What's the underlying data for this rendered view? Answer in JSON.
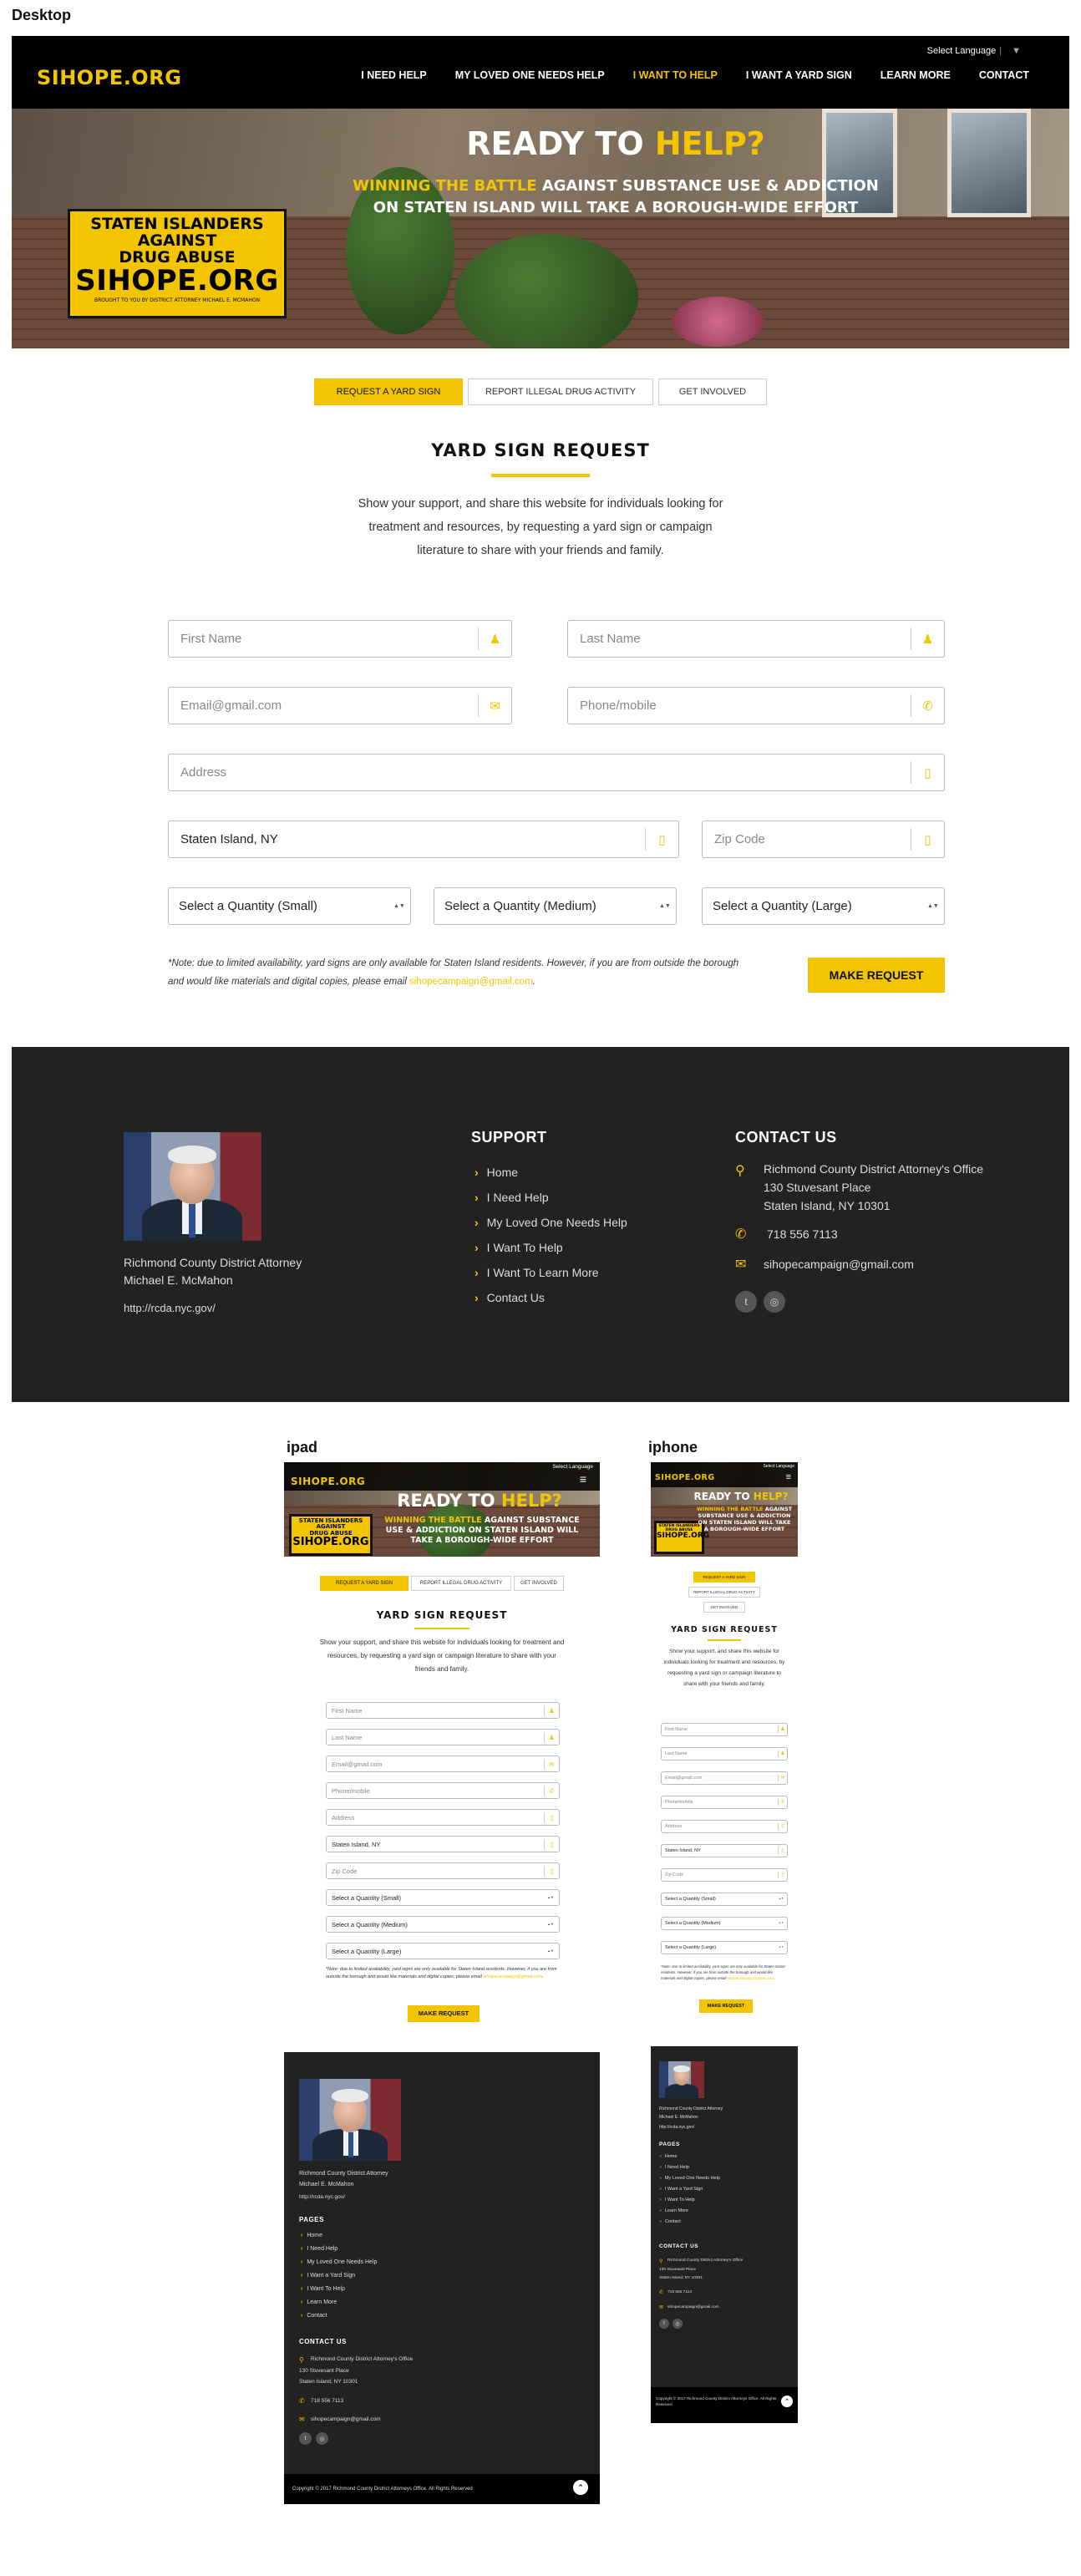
{
  "labels": {
    "desktop": "Desktop",
    "ipad": "ipad",
    "iphone": "iphone"
  },
  "site": {
    "logo": "SIHOPE.ORG",
    "language": "Select Language",
    "language_arrow": "▼",
    "menu_icon": "≡",
    "nav": [
      "I NEED HELP",
      "MY LOVED ONE NEEDS HELP",
      "I WANT TO HELP",
      "I WANT A YARD SIGN",
      "LEARN MORE",
      "CONTACT"
    ]
  },
  "hero": {
    "title_a": "READY TO ",
    "title_b": "HELP?",
    "line1_a": "WINNING THE BATTLE",
    "line1_b": " AGAINST SUBSTANCE USE & ADDICTION",
    "line2": "ON STATEN ISLAND WILL TAKE A BOROUGH-WIDE EFFORT",
    "sign_1": "STATEN ISLANDERS",
    "sign_2": "AGAINST",
    "sign_3": "DRUG ABUSE",
    "sign_4": "SIHOPE.ORG",
    "sign_5": "BROUGHT TO YOU BY DISTRICT ATTORNEY MICHAEL E. MCMAHON"
  },
  "tabs": [
    "REQUEST A YARD SIGN",
    "REPORT ILLEGAL DRUG ACTIVITY",
    "GET INVOLVED"
  ],
  "form": {
    "title": "YARD SIGN REQUEST",
    "intro": "Show your support, and share this website for individuals looking for treatment and resources, by requesting a yard sign or campaign literature to share with your friends and family.",
    "first_name": "First Name",
    "last_name": "Last Name",
    "email": "Email@gmail.com",
    "phone": "Phone/mobile",
    "address": "Address",
    "city": "Staten Island, NY",
    "zip": "Zip Code",
    "qty_small": "Select a Quantity (Small)",
    "qty_medium": "Select a Quantity (Medium)",
    "qty_large": "Select a Quantity (Large)",
    "note": "*Note: due to limited availability, yard signs are only available for Staten Island residents. However, if you are from outside the borough and would like materials and digital copies, please email ",
    "note_email": "sihopecampaign@gmail.com",
    "note_end": ".",
    "submit": "MAKE REQUEST"
  },
  "footer": {
    "da_title": "Richmond County District Attorney",
    "da_name": "Michael E. McMahon",
    "url": "http://rcda.nyc.gov/",
    "support_title": "SUPPORT",
    "pages_title": "PAGES",
    "links": [
      "Home",
      "I Need Help",
      "My Loved One Needs Help",
      "I Want To Help",
      "I Want To Learn More",
      "Contact Us"
    ],
    "mobile_links": [
      "Home",
      "I Need Help",
      "My Loved One Needs Help",
      "I Want a Yard Sign",
      "I Want To Help",
      "Learn More",
      "Contact"
    ],
    "contact_title": "CONTACT US",
    "office": "Richmond County District Attorney's Office",
    "street": "130 Stuvesant Place",
    "city": "Staten Island, NY 10301",
    "phone": "718 556 7113",
    "email": "sihopecampaign@gmail.com",
    "copyright": "Copyright © 2017 Richmond County District Attorneys Office. All Rights Reserved"
  },
  "icons": {
    "person": "♟",
    "mail": "✉",
    "phone": "✆",
    "building": "▯",
    "pin": "⚲",
    "twitter": "t",
    "instagram": "◎",
    "chevron": "›",
    "up": "⌃",
    "select_arrows": "▲▼"
  },
  "colors": {
    "accent": "#f2c500",
    "footer_bg": "#222222",
    "nav_bg": "#000000"
  }
}
